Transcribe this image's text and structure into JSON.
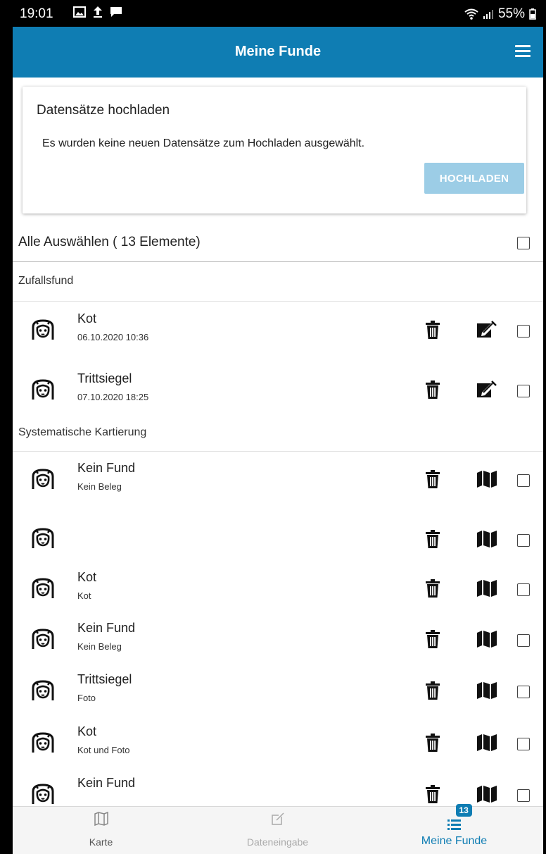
{
  "statusbar": {
    "time": "19:01",
    "battery": "55%"
  },
  "appbar": {
    "title": "Meine Funde"
  },
  "upload_card": {
    "title": "Datensätze hochladen",
    "message": "Es wurden keine neuen Datensätze zum Hochladen ausgewählt.",
    "button": "HOCHLADEN"
  },
  "select_all": {
    "label": "Alle Auswählen ( 13 Elemente)"
  },
  "sections": [
    {
      "title": "Zufallsfund",
      "items": [
        {
          "title": "Kot",
          "subtitle": "06.10.2020 10:36",
          "action_icon": "edit-icon"
        },
        {
          "title": "Trittsiegel",
          "subtitle": "07.10.2020 18:25",
          "action_icon": "edit-icon"
        }
      ]
    },
    {
      "title": "Systematische Kartierung",
      "items": [
        {
          "title": "Kein Fund",
          "subtitle": "Kein Beleg",
          "action_icon": "map-icon"
        },
        {
          "title": "",
          "subtitle": "",
          "action_icon": "map-icon"
        },
        {
          "title": "Kot",
          "subtitle": "Kot",
          "action_icon": "map-icon"
        },
        {
          "title": "Kein Fund",
          "subtitle": "Kein Beleg",
          "action_icon": "map-icon"
        },
        {
          "title": "Trittsiegel",
          "subtitle": "Foto",
          "action_icon": "map-icon"
        },
        {
          "title": "Kot",
          "subtitle": "Kot und Foto",
          "action_icon": "map-icon"
        },
        {
          "title": "Kein Fund",
          "subtitle": "",
          "action_icon": "map-icon"
        }
      ]
    }
  ],
  "bottom_nav": {
    "items": [
      {
        "label": "Karte",
        "icon": "map-outline-icon",
        "state": "normal"
      },
      {
        "label": "Dateneingabe",
        "icon": "edit-outline-icon",
        "state": "disabled"
      },
      {
        "label": "Meine Funde",
        "icon": "list-icon",
        "state": "active",
        "badge": "13"
      }
    ]
  },
  "colors": {
    "primary": "#0f7db3",
    "button_disabled": "#9ccde6",
    "nav_background": "#f5f5f5"
  }
}
